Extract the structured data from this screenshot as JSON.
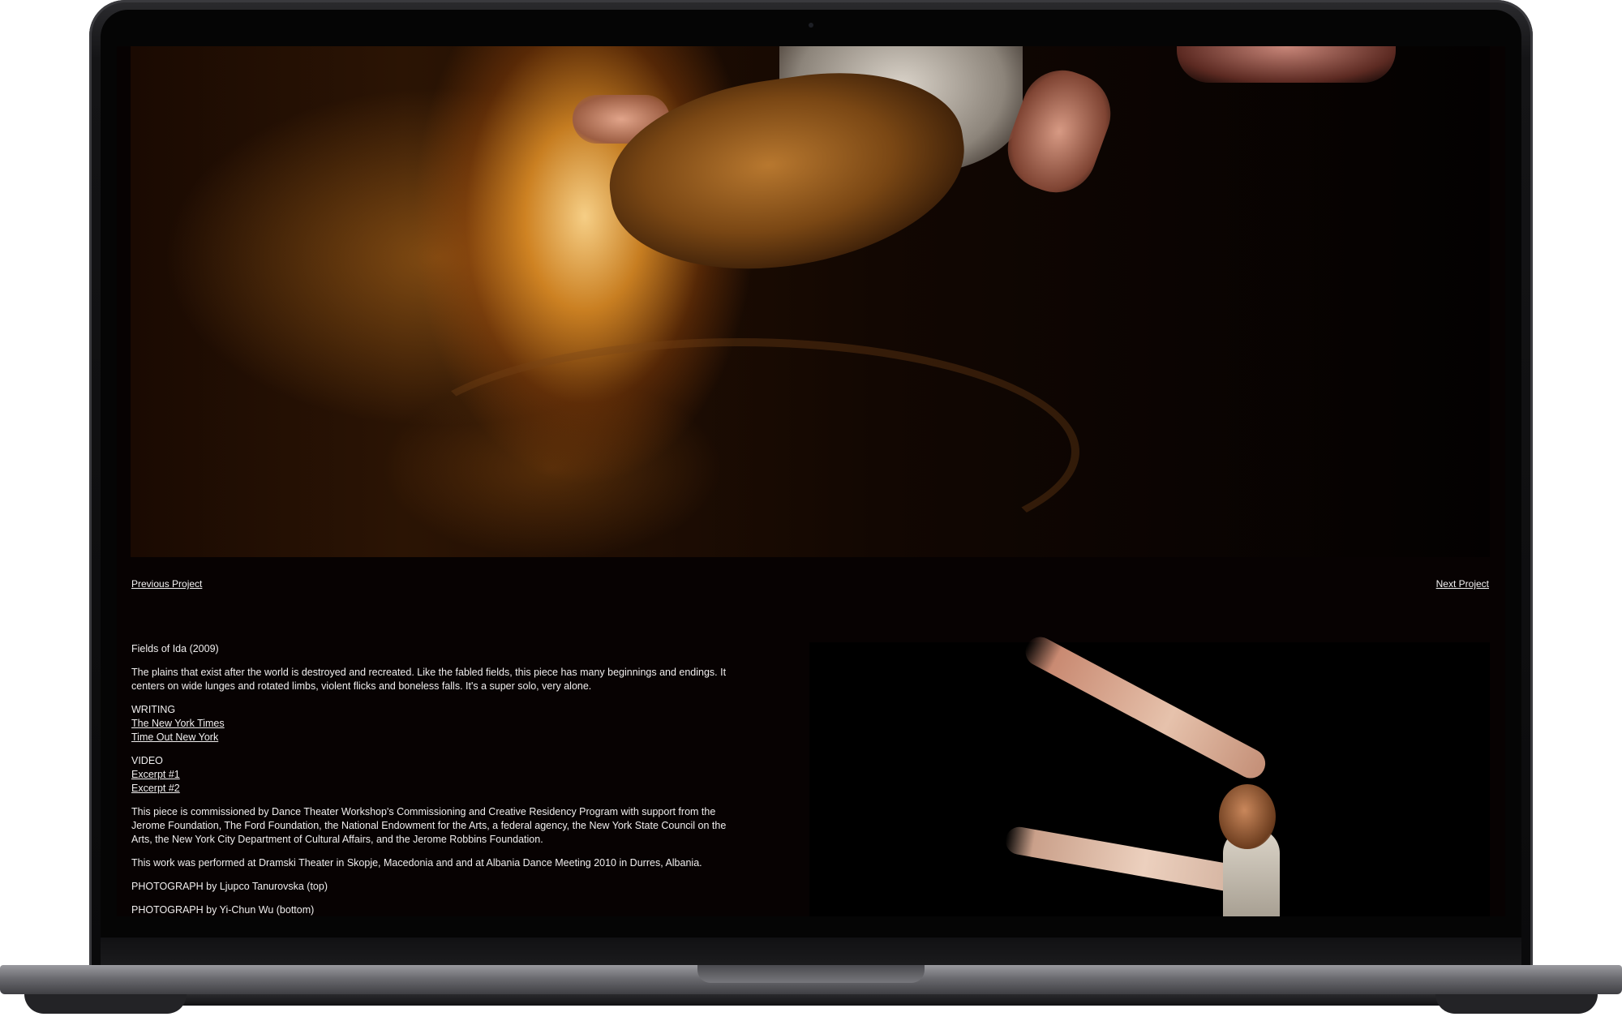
{
  "project": {
    "nav": {
      "previous_label": "Previous Project",
      "next_label": "Next Project"
    },
    "title": "Fields of Ida (2009)",
    "description": "The plains that exist after the world is destroyed and recreated. Like the fabled fields, this piece has many beginnings and endings. It centers on wide lunges and rotated limbs, violent flicks and boneless falls. It's a super solo, very alone.",
    "writing": {
      "heading": "WRITING",
      "links": [
        "The New York Times",
        "Time Out New York"
      ]
    },
    "video": {
      "heading": "VIDEO",
      "links": [
        "Excerpt #1",
        "Excerpt #2"
      ]
    },
    "commission": "This piece is commissioned by Dance Theater Workshop's Commissioning and Creative Residency Program with support from the Jerome Foundation, The Ford Foundation, the National Endowment for the Arts, a federal agency, the New York State Council on the Arts, the New York City Department of Cultural Affairs, and the Jerome Robbins Foundation.",
    "performed": "This work was performed at Dramski Theater in Skopje, Macedonia and and at Albania Dance Meeting 2010 in Durres, Albania.",
    "photo_credit_top": "PHOTOGRAPH by Ljupco Tanurovska (top)",
    "photo_credit_bottom": "PHOTOGRAPH by Yi-Chun Wu (bottom)"
  },
  "colors": {
    "page_background": "#070202",
    "text": "#f0eeee"
  }
}
